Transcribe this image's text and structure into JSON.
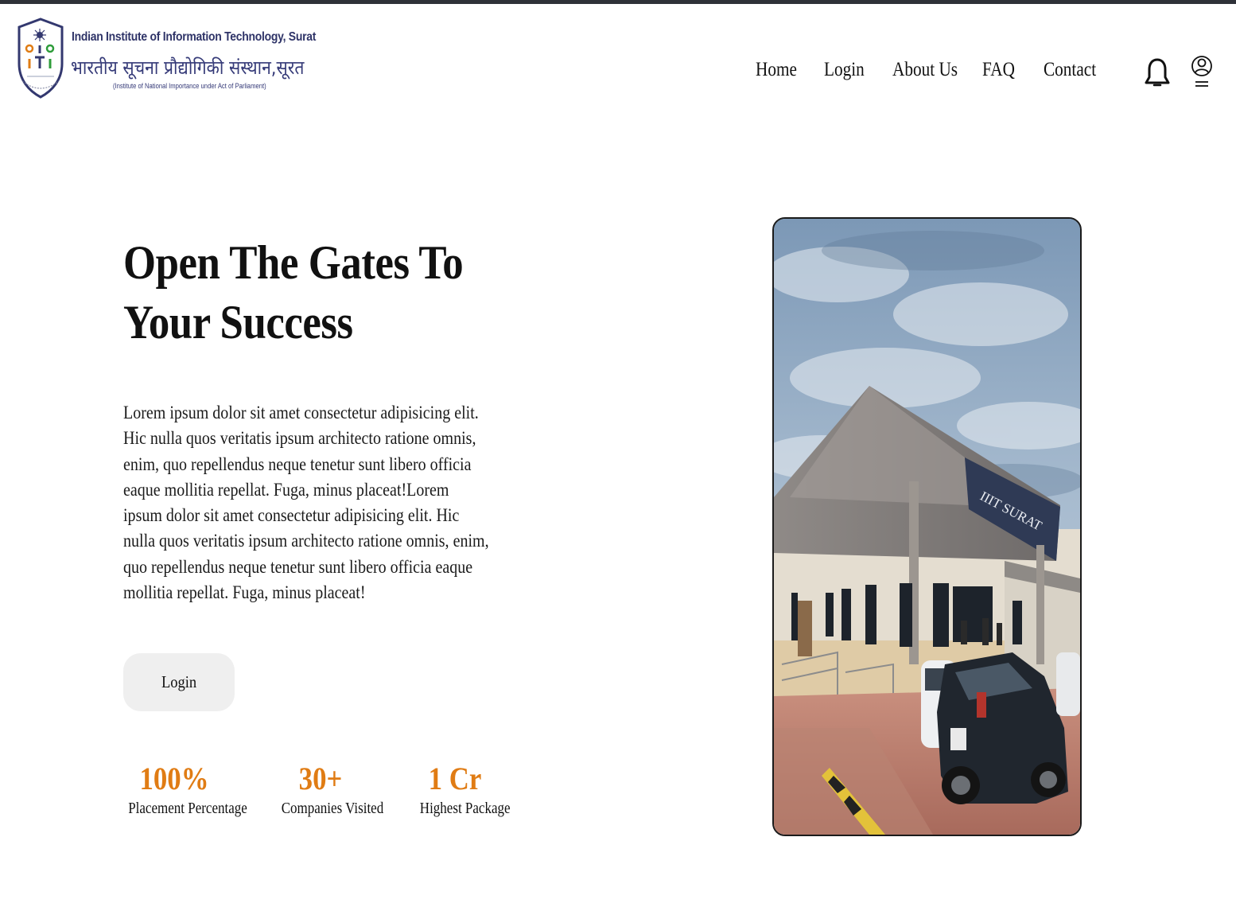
{
  "header": {
    "institute_name_en": "Indian Institute of Information Technology, Surat",
    "institute_name_hi": "भारतीय सूचना प्रौद्योगिकी संस्थान,सूरत",
    "institute_subtitle": "(Institute of National Importance under Act of Parliament)",
    "nav": [
      {
        "label": "Home"
      },
      {
        "label": "Login"
      },
      {
        "label": "About Us"
      },
      {
        "label": "FAQ"
      },
      {
        "label": "Contact"
      }
    ],
    "icons": {
      "notifications": "bell-icon",
      "profile": "user-icon"
    }
  },
  "hero": {
    "title": "Open The Gates To Your Success",
    "description": "Lorem ipsum dolor sit amet consectetur adipisicing elit. Hic nulla quos veritatis ipsum architecto ratione omnis, enim, quo repellendus neque tenetur sunt libero officia eaque mollitia repellat. Fuga, minus placeat!Lorem ipsum dolor sit amet consectetur adipisicing elit. Hic nulla quos veritatis ipsum architecto ratione omnis, enim, quo repellendus neque tenetur sunt libero officia eaque mollitia repellat. Fuga, minus placeat!",
    "login_label": "Login",
    "stats": [
      {
        "value": "100%",
        "label": "Placement Percentage"
      },
      {
        "value": "30+",
        "label": "Companies Visited"
      },
      {
        "value": "1 Cr",
        "label": "Highest Package"
      }
    ]
  },
  "campus_image": {
    "building_sign": "IIIT SURAT"
  },
  "colors": {
    "accent": "#e07c14",
    "logo_navy": "#2f3468",
    "button_bg": "#efefef",
    "top_strip": "#2e3138"
  }
}
